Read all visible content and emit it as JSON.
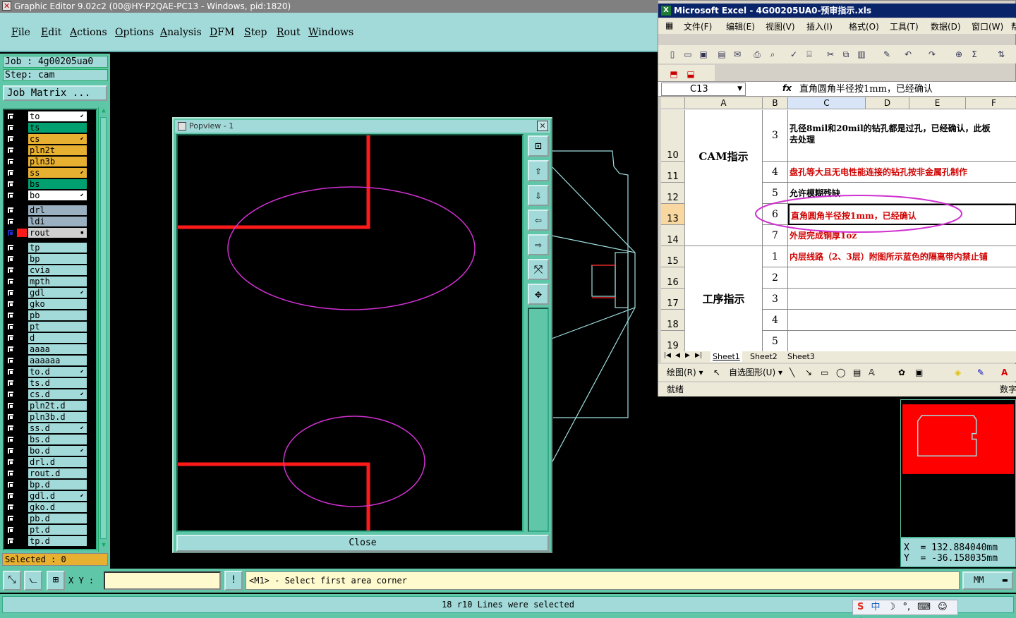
{
  "graphic_editor": {
    "title": "Graphic Editor 9.02c2 (00@HY-P2QAE-PC13 - Windows, pid:1820)",
    "menu": [
      "File",
      "Edit",
      "Actions",
      "Options",
      "Analysis",
      "DFM",
      "Step",
      "Rout",
      "Windows"
    ],
    "job": "Job : 4g00205ua0",
    "step": "Step: cam",
    "job_matrix": "Job Matrix ...",
    "layers": [
      {
        "name": "to",
        "style": "sig",
        "flag": "⬋"
      },
      {
        "name": "ts",
        "style": "mask",
        "flag": ""
      },
      {
        "name": "cs",
        "style": "yellow",
        "flag": "⬋"
      },
      {
        "name": "pln2t",
        "style": "yellow",
        "flag": ""
      },
      {
        "name": "pln3b",
        "style": "yellow",
        "flag": ""
      },
      {
        "name": "ss",
        "style": "yellow",
        "flag": "⬋"
      },
      {
        "name": "bs",
        "style": "mask",
        "flag": ""
      },
      {
        "name": "bo",
        "style": "sig",
        "flag": "⬋"
      },
      {
        "name": "drl",
        "style": "grey",
        "flag": ""
      },
      {
        "name": "ldi",
        "style": "grey",
        "flag": ""
      },
      {
        "name": "rout",
        "style": "rout",
        "flag": "▪"
      },
      {
        "name": "tp",
        "style": "plain",
        "flag": ""
      },
      {
        "name": "bp",
        "style": "plain",
        "flag": ""
      },
      {
        "name": "cvia",
        "style": "plain",
        "flag": ""
      },
      {
        "name": "mpth",
        "style": "plain",
        "flag": ""
      },
      {
        "name": "gdl",
        "style": "plain",
        "flag": "⬋"
      },
      {
        "name": "gko",
        "style": "plain",
        "flag": ""
      },
      {
        "name": "pb",
        "style": "plain",
        "flag": ""
      },
      {
        "name": "pt",
        "style": "plain",
        "flag": ""
      },
      {
        "name": "d",
        "style": "plain",
        "flag": ""
      },
      {
        "name": "aaaa",
        "style": "plain",
        "flag": ""
      },
      {
        "name": "aaaaaa",
        "style": "plain",
        "flag": ""
      },
      {
        "name": "to.d",
        "style": "plain",
        "flag": "⬋"
      },
      {
        "name": "ts.d",
        "style": "plain",
        "flag": ""
      },
      {
        "name": "cs.d",
        "style": "plain",
        "flag": "⬋"
      },
      {
        "name": "pln2t.d",
        "style": "plain",
        "flag": ""
      },
      {
        "name": "pln3b.d",
        "style": "plain",
        "flag": ""
      },
      {
        "name": "ss.d",
        "style": "plain",
        "flag": "⬋"
      },
      {
        "name": "bs.d",
        "style": "plain",
        "flag": ""
      },
      {
        "name": "bo.d",
        "style": "plain",
        "flag": "⬋"
      },
      {
        "name": "drl.d",
        "style": "plain",
        "flag": ""
      },
      {
        "name": "rout.d",
        "style": "plain",
        "flag": ""
      },
      {
        "name": "bp.d",
        "style": "plain",
        "flag": ""
      },
      {
        "name": "gdl.d",
        "style": "plain",
        "flag": "⬋"
      },
      {
        "name": "gko.d",
        "style": "plain",
        "flag": ""
      },
      {
        "name": "pb.d",
        "style": "plain",
        "flag": ""
      },
      {
        "name": "pt.d",
        "style": "plain",
        "flag": ""
      },
      {
        "name": "tp.d",
        "style": "plain",
        "flag": ""
      }
    ],
    "selected": "Selected : 0",
    "xy_label": "X Y :",
    "xy_value": "",
    "prompt": "<M1> - Select first area corner",
    "units": "MM",
    "status": "18 r10 Lines were selected",
    "coords": "X  = 132.884040mm\nY  = -36.158035mm"
  },
  "popview": {
    "title": "Popview - 1",
    "close_label": "Close",
    "tools": [
      "zoom-in-icon",
      "pan-up-icon",
      "pan-down-icon",
      "pan-left-icon",
      "pan-right-icon",
      "zoom-fit-icon",
      "zoom-home-icon"
    ]
  },
  "excel": {
    "title": "Microsoft Excel - 4G00205UA0-预审指示.xls",
    "menu": [
      "文件(F)",
      "编辑(E)",
      "视图(V)",
      "插入(I)",
      "格式(O)",
      "工具(T)",
      "数据(D)",
      "窗口(W)",
      "帮"
    ],
    "name_box": "C13",
    "fx": "fx",
    "formula": "直角圆角半径按1mm，已经确认",
    "columns": [
      "A",
      "B",
      "C",
      "D",
      "E",
      "F"
    ],
    "row_numbers": [
      "10",
      "11",
      "12",
      "13",
      "14",
      "15",
      "16",
      "17",
      "18",
      "19"
    ],
    "group_cam": "CAM指示",
    "group_process": "工序指示",
    "cam_rows": [
      {
        "num": "3",
        "text": "孔径8mil和20mil的钻孔都是过孔，已经确认，此板\n去处理",
        "red": false
      },
      {
        "num": "4",
        "text": "盘孔等大且无电性能连接的钻孔按非金属孔制作",
        "red": true
      },
      {
        "num": "5",
        "text": "允许模糊残缺",
        "red": false
      },
      {
        "num": "6",
        "text": "直角圆角半径按1mm，已经确认",
        "red": true
      },
      {
        "num": "7",
        "text": "外层完成铜厚1oz",
        "red": true
      }
    ],
    "process_rows": [
      {
        "num": "1",
        "text": "内层线路（2、3层）附图所示蓝色的隔离带内禁止铺",
        "red": true
      },
      {
        "num": "2",
        "text": "",
        "red": false
      },
      {
        "num": "3",
        "text": "",
        "red": false
      },
      {
        "num": "4",
        "text": "",
        "red": false
      },
      {
        "num": "5",
        "text": "",
        "red": false
      }
    ],
    "sheets": [
      "Sheet1",
      "Sheet2",
      "Sheet3"
    ],
    "draw_label": "绘图(R) ▾",
    "autoshape_label": "自选图形(U) ▾",
    "status_ready": "就绪",
    "status_num": "数字"
  },
  "colors": {
    "panel": "#5fc7a8",
    "panel_light": "#a2d9d9",
    "trace_red": "#ff1a1a",
    "ellipse_magenta": "#d030d0",
    "outline_cyan": "#a0e0e0"
  }
}
